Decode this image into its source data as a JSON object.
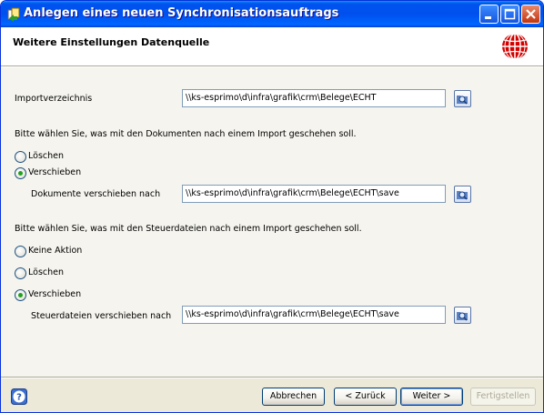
{
  "window": {
    "title": "Anlegen eines neuen Synchronisationsauftrags",
    "header_title": "Weitere Einstellungen Datenquelle"
  },
  "import": {
    "label": "Importverzeichnis",
    "value": "\\\\ks-esprimo\\d\\infra\\grafik\\crm\\Belege\\ECHT"
  },
  "documents": {
    "question": "Bitte wählen Sie, was mit den Dokumenten nach einem Import geschehen soll.",
    "options": [
      {
        "label": "Löschen",
        "checked": false
      },
      {
        "label": "Verschieben",
        "checked": true
      }
    ],
    "move_label": "Dokumente verschieben nach",
    "move_value": "\\\\ks-esprimo\\d\\infra\\grafik\\crm\\Belege\\ECHT\\save"
  },
  "control_files": {
    "question": "Bitte wählen Sie, was mit den Steuerdateien nach einem Import geschehen soll.",
    "options": [
      {
        "label": "Keine Aktion",
        "checked": false
      },
      {
        "label": "Löschen",
        "checked": false
      },
      {
        "label": "Verschieben",
        "checked": true
      }
    ],
    "move_label": "Steuerdateien verschieben nach",
    "move_value": "\\\\ks-esprimo\\d\\infra\\grafik\\crm\\Belege\\ECHT\\save"
  },
  "footer": {
    "cancel": "Abbrechen",
    "back": "< Zurück",
    "next": "Weiter >",
    "finish": "Fertigstellen"
  },
  "icons": {
    "app": "app-icon",
    "globe": "globe-logo-icon",
    "browse": "folder-browse-icon",
    "help": "help-icon"
  },
  "colors": {
    "titlebar": "#0054e3",
    "face": "#ece9d8",
    "content": "#f5f4ee",
    "radio_dot": "#21a121",
    "globe": "#d40000"
  }
}
